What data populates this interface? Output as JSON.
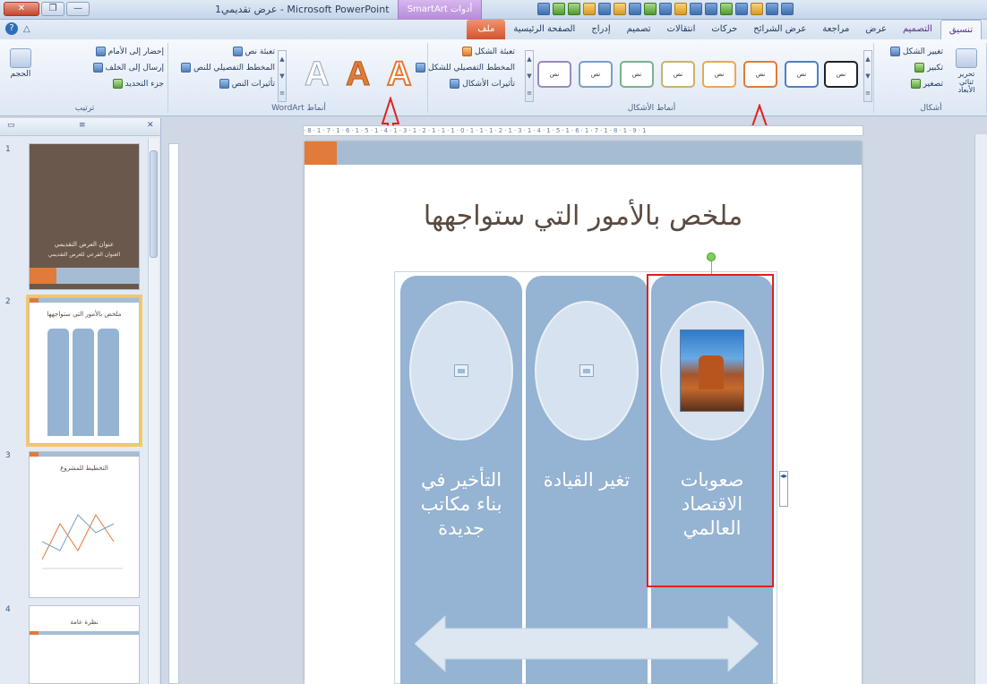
{
  "titlebar": {
    "app_title": "Microsoft PowerPoint - عرض تقديمي1",
    "context_tab": "SmartArt أدوات",
    "controls": [
      "—",
      "❐",
      "✕"
    ]
  },
  "tabs": {
    "file": "ملف",
    "items": [
      "الصفحة الرئيسية",
      "إدراج",
      "تصميم",
      "انتقالات",
      "حركات",
      "عرض الشرائح",
      "مراجعة",
      "عرض",
      "التصميم",
      "تنسيق"
    ],
    "active_index": 9
  },
  "ribbon": {
    "shapes_group": {
      "label": "أشكال",
      "change_shape": "تغيير الشكل",
      "larger": "تكبير",
      "smaller": "تصغير",
      "edit_2d": "تحرير ثنائي الأبعاد"
    },
    "shape_styles_group": {
      "label": "أنماط الأشكال",
      "style_text": "نص",
      "fill": "تعبئة الشكل",
      "outline": "المخطط التفصيلي للشكل",
      "effects": "تأثيرات الأشكال"
    },
    "wordart_group": {
      "label": "أنماط WordArt",
      "text_fill": "تعبئة نص",
      "text_outline": "المخطط التفصيلي للنص",
      "text_effects": "تأثيرات النص"
    },
    "arrange_group": {
      "label": "ترتيب",
      "bring_forward": "إحضار إلى الأمام",
      "send_backward": "إرسال إلى الخلف",
      "selection_pane": "جزء التحديد",
      "size": "الحجم"
    }
  },
  "panel": {
    "tab_slides": "شرائح",
    "tab_outline": "مخطط تفصيلي",
    "slides": [
      {
        "num": "1",
        "title": "عنوان العرض التقديمي",
        "subtitle": "العنوان الفرعي للعرض التقديمي"
      },
      {
        "num": "2",
        "title": "ملخص بالأمور التي ستواجهها"
      },
      {
        "num": "3",
        "title": "التخطيط للمشروع"
      },
      {
        "num": "4",
        "title": "نظرة عامة"
      }
    ]
  },
  "slide": {
    "title": "ملخص بالأمور التي ستواجهها",
    "columns": [
      {
        "text": "صعوبات الاقتصاد العالمي",
        "has_photo": true
      },
      {
        "text": "تغير القيادة",
        "has_photo": false
      },
      {
        "text": "التأخير في بناء مكاتب جديدة",
        "has_photo": false
      }
    ]
  },
  "colors": {
    "file_tab": "#d2542c",
    "context_tab": "#b58ad9",
    "slide_accent": "#e07b39",
    "slide_bar": "#a6bcd3",
    "smartart_column": "#95b3d2",
    "selection_red": "#e02020"
  }
}
